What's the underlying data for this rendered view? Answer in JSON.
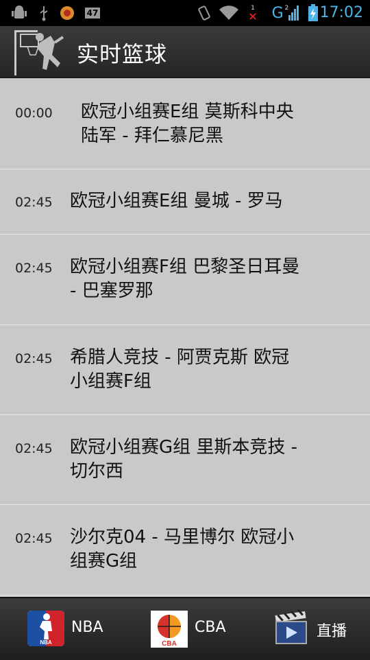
{
  "status_bar": {
    "time": "17:02",
    "notification_badge": "47",
    "network_label": "G",
    "signal_count": "2",
    "missed_badge": "1",
    "accent_color": "#4fb3e8"
  },
  "header": {
    "title": "实时篮球",
    "background_color": "#2e2e2e"
  },
  "matches": [
    {
      "time": "00:00",
      "title": "欧冠小组赛E组 莫斯科中央\n陆军 - 拜仁慕尼黑"
    },
    {
      "time": "02:45",
      "title": "欧冠小组赛E组 曼城 - 罗马"
    },
    {
      "time": "02:45",
      "title": "欧冠小组赛F组 巴黎圣日耳曼\n- 巴塞罗那"
    },
    {
      "time": "02:45",
      "title": "希腊人竞技 - 阿贾克斯 欧冠\n小组赛F组"
    },
    {
      "time": "02:45",
      "title": "欧冠小组赛G组 里斯本竞技 -\n切尔西"
    },
    {
      "time": "02:45",
      "title": "沙尔克04 - 马里博尔 欧冠小\n组赛G组"
    }
  ],
  "tabs": [
    {
      "label": "NBA",
      "icon": "nba-logo-icon"
    },
    {
      "label": "CBA",
      "icon": "cba-logo-icon"
    },
    {
      "label": "直播",
      "icon": "clapperboard-icon"
    }
  ]
}
